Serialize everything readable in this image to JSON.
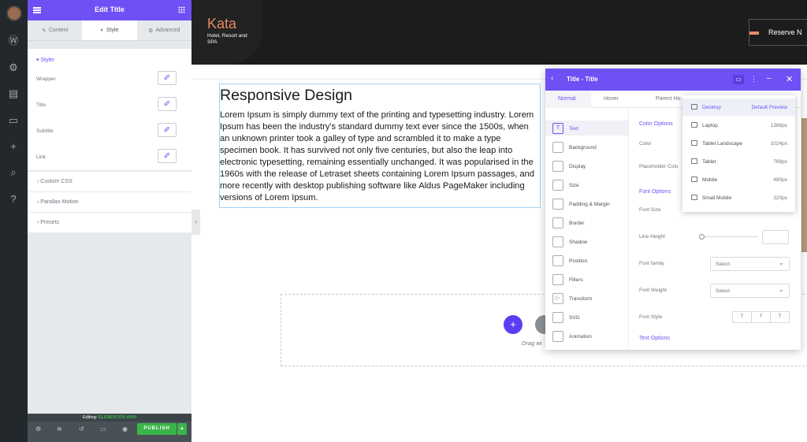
{
  "wp_sidebar": {
    "icons": [
      "avatar",
      "wordpress-icon",
      "settings-icon",
      "chart-icon",
      "folder-icon",
      "plus-icon",
      "search-icon",
      "help-icon"
    ]
  },
  "panel": {
    "title": "Edit Title",
    "tabs": [
      "Content",
      "Style",
      "Advanced"
    ],
    "active_tab": "Style",
    "styler_label": "Styler",
    "styler_rows": [
      "Wrapper",
      "Title",
      "Subtitle",
      "Link"
    ],
    "collapsibles": [
      "Custom CSS",
      "Parallax Motion",
      "Presets"
    ],
    "footer": {
      "editing_prefix": "Editing:",
      "editing_name": "ELEMENTOR #509",
      "publish": "PUBLISH"
    }
  },
  "site": {
    "logo_name": "Kata",
    "logo_sub": "Hotel, Resort and SPA",
    "reserve_button": "Reserve N"
  },
  "content": {
    "heading": "Responsive Design",
    "paragraph": "Lorem Ipsum is simply dummy text of the printing and typesetting industry. Lorem Ipsum has been the industry's standard dummy text ever since the 1500s, when an unknown printer took a galley of type and scrambled it to make a type specimen book. It has survived not only five centuries, but also the leap into electronic typesetting, remaining essentially unchanged. It was popularised in the 1960s with the release of Letraset sheets containing Lorem Ipsum passages, and more recently with desktop publishing software like Aldus PageMaker including versions of Lorem Ipsum.",
    "drag_text": "Drag wi"
  },
  "modal": {
    "title": "Title - Title",
    "tabs": [
      "Normal",
      "Hover",
      "Parent Ho"
    ],
    "side_items": [
      "Text",
      "Background",
      "Display",
      "Size",
      "Padding & Margin",
      "Border",
      "Shadow",
      "Position",
      "Filters",
      "Transform",
      "SVG",
      "Animation"
    ],
    "active_item": "Text",
    "labels": {
      "color_options": "Color Options",
      "color": "Color",
      "placeholder_color": "Placeholder Colo",
      "font_options": "Font Options",
      "font_size": "Font Size",
      "line_height": "Line Height",
      "font_family": "Font family",
      "font_weight": "Font Weight",
      "font_style": "Font Style",
      "text_options": "Text Options"
    },
    "select_placeholder": "Select",
    "font_style_buttons": [
      "T",
      "T",
      "T"
    ]
  },
  "responsive_dropdown": [
    {
      "name": "Desktop",
      "value": "Default Preview"
    },
    {
      "name": "Laptop",
      "value": "1366px"
    },
    {
      "name": "Tablet Landscape",
      "value": "1024px"
    },
    {
      "name": "Tablet",
      "value": "768px"
    },
    {
      "name": "Mobile",
      "value": "480px"
    },
    {
      "name": "Small Mobile",
      "value": "320px"
    }
  ],
  "colors": {
    "accent": "#6e50f5",
    "publish": "#39b54a",
    "brand": "#e88a63"
  }
}
